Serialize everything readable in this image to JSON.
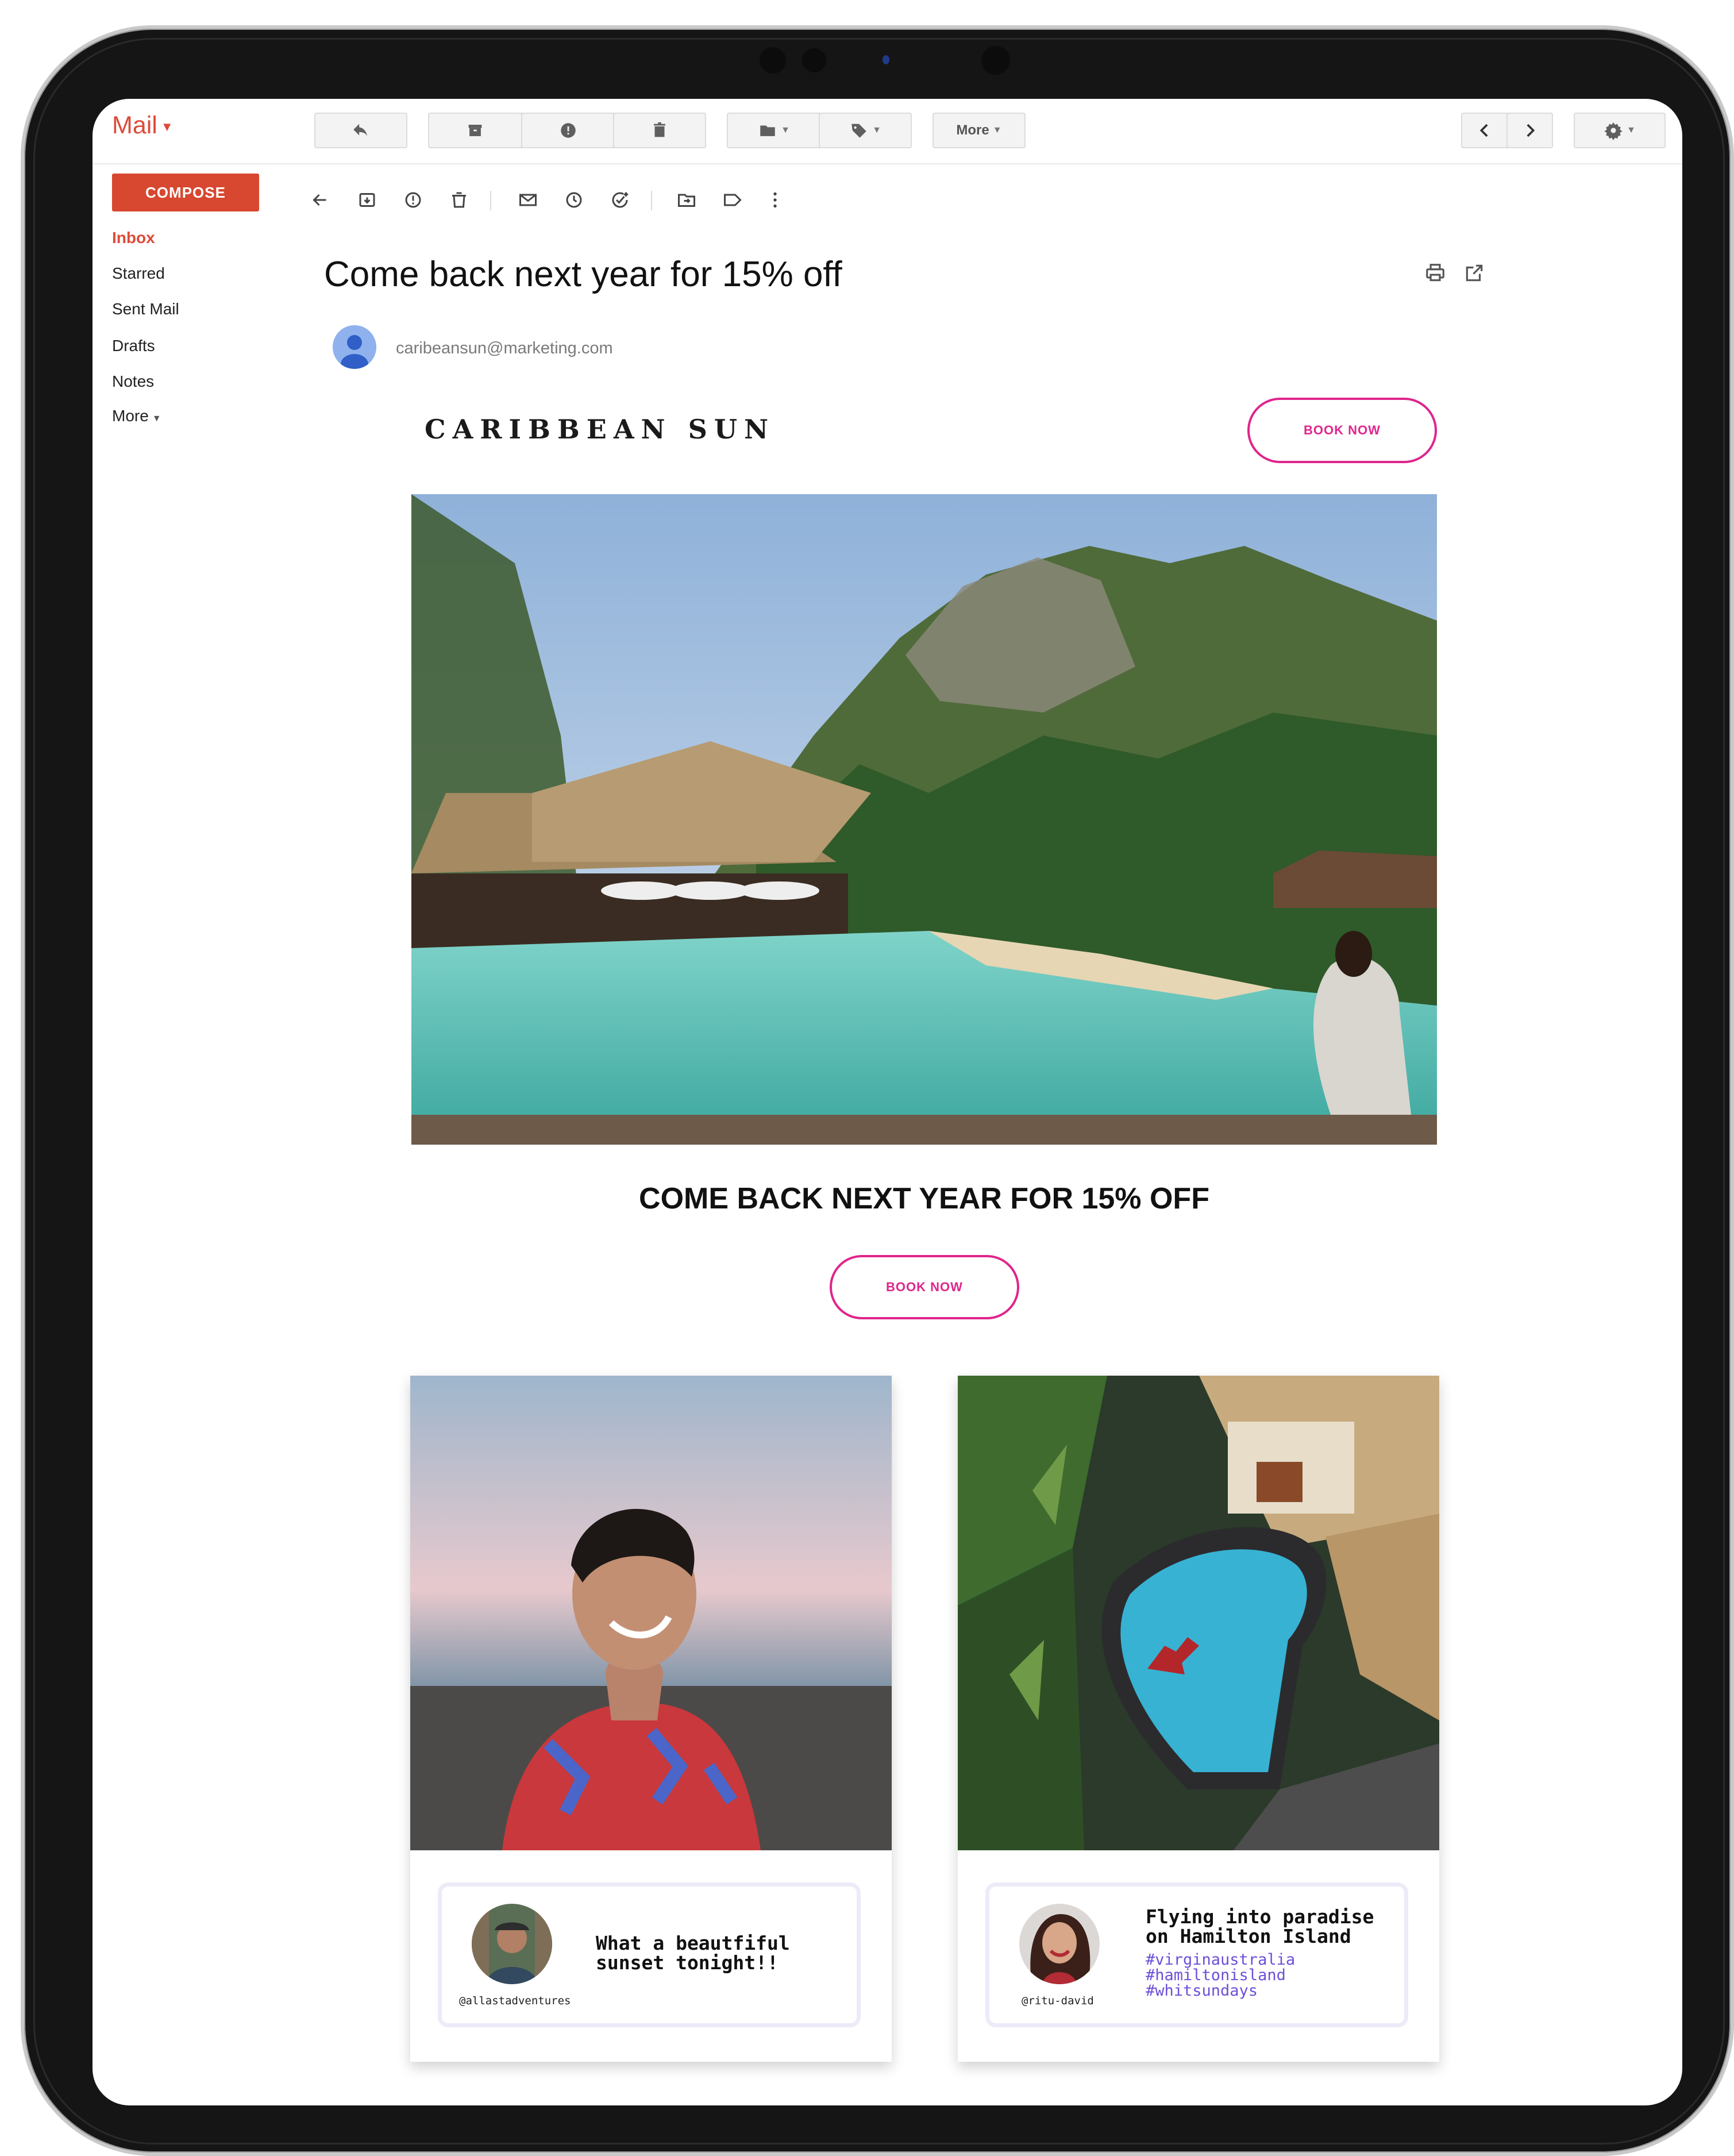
{
  "app": {
    "logo": "Mail",
    "compose_label": "COMPOSE",
    "toolbar_more_label": "More"
  },
  "nav": {
    "items": [
      {
        "label": "Inbox",
        "active": true
      },
      {
        "label": "Starred",
        "active": false
      },
      {
        "label": "Sent Mail",
        "active": false
      },
      {
        "label": "Drafts",
        "active": false
      },
      {
        "label": "Notes",
        "active": false
      },
      {
        "label": "More",
        "active": false
      }
    ]
  },
  "email": {
    "subject": "Come back next year for 15% off",
    "sender": "caribeansun@marketing.com",
    "brand": "CARIBBEAN SUN",
    "book_now_label": "BOOK NOW",
    "headline": "COME BACK NEXT YEAR FOR 15% OFF"
  },
  "posts": [
    {
      "handle": "@allastadventures",
      "caption_lines": [
        "What a beautfiful",
        "sunset tonight!!"
      ],
      "hashtags": []
    },
    {
      "handle": "@ritu-david",
      "caption_lines": [
        "Flying into paradise",
        "on Hamilton Island"
      ],
      "hashtags": [
        "#virginaustralia",
        "#hamiltonisland",
        "#whitsundays"
      ]
    }
  ],
  "colors": {
    "brand_red": "#dd4b39",
    "compose_red": "#d8472f",
    "cta_pink": "#e0258d",
    "hashtag_purple": "#6d4fd8"
  }
}
